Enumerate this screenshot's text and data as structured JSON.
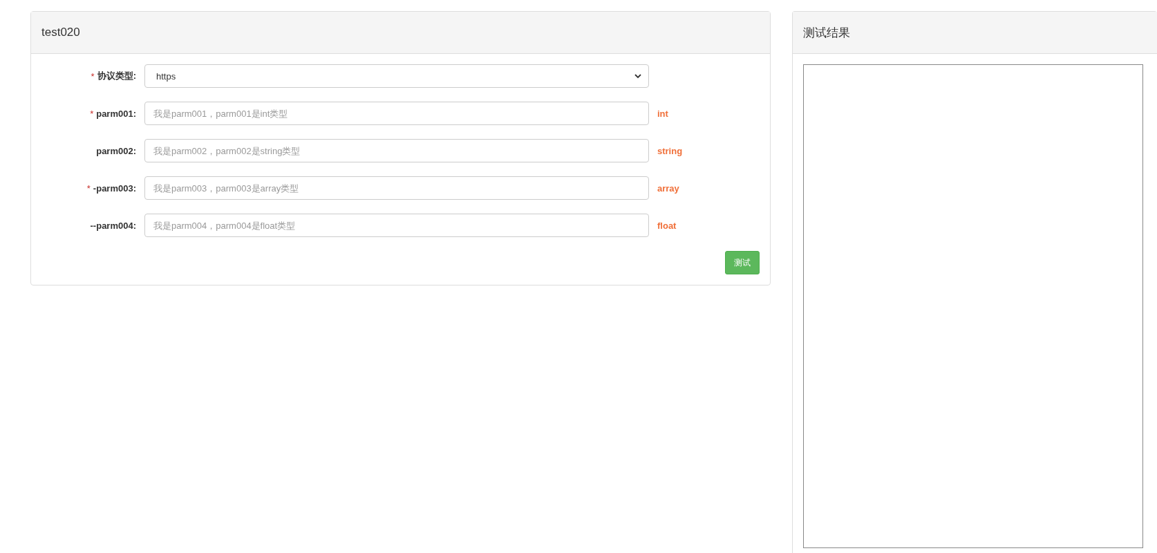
{
  "form_panel": {
    "title": "test020",
    "protocol": {
      "required_mark": "*",
      "label": "协议类型:",
      "value": "https"
    },
    "params": [
      {
        "required_mark": "*",
        "label": "parm001:",
        "placeholder": "我是parm001，parm001是int类型",
        "type": "int"
      },
      {
        "label": "parm002:",
        "placeholder": "我是parm002，parm002是string类型",
        "type": "string"
      },
      {
        "required_mark": "*",
        "label": "-parm003:",
        "placeholder": "我是parm003，parm003是array类型",
        "type": "array"
      },
      {
        "label": "--parm004:",
        "placeholder": "我是parm004，parm004是float类型",
        "type": "float"
      }
    ],
    "submit_button": "测试"
  },
  "result_panel": {
    "title": "测试结果"
  }
}
